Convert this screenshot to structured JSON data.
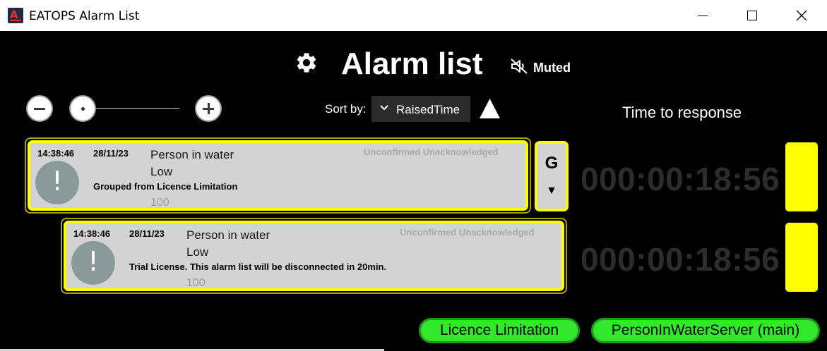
{
  "window": {
    "title": "EATOPS Alarm List"
  },
  "header": {
    "title": "Alarm list",
    "settings_icon": "gear-icon",
    "mute_icon": "speaker-muted-icon",
    "mute_status": "Muted"
  },
  "zoom": {
    "out_icon": "minus-icon",
    "in_icon": "plus-icon",
    "level": 0
  },
  "sort": {
    "label": "Sort by:",
    "selected": "RaisedTime",
    "direction": "ascending"
  },
  "time_to_response_label": "Time to response",
  "alarms": [
    {
      "time": "14:38:46",
      "date": "28/11/23",
      "title": "Person in water",
      "severity": "Low",
      "message": "Grouped from Licence Limitation",
      "number": "100",
      "status": "Unconfirmed  Unacknowledged",
      "timer": "000:00:18:56",
      "group_label": "G",
      "group_arrow": "▼"
    },
    {
      "time": "14:38:46",
      "date": "28/11/23",
      "title": "Person in water",
      "severity": "Low",
      "message": "Trial License. This alarm list will be disconnected in 20min.",
      "number": "100",
      "status": "Unconfirmed  Unacknowledged",
      "timer": "000:00:18:56"
    }
  ],
  "servers": [
    {
      "label": "Licence Limitation"
    },
    {
      "label": "PersonInWaterServer (main)"
    }
  ],
  "colors": {
    "accent_yellow": "#ffff00",
    "server_green": "#33e82a",
    "card_bg": "#d3d3d3"
  }
}
